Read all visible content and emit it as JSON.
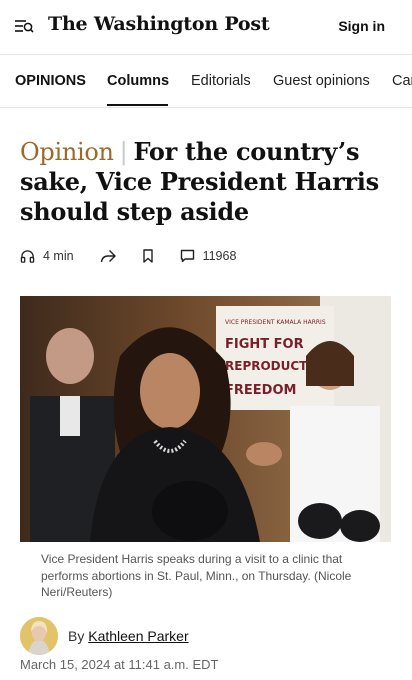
{
  "header": {
    "masthead": "The Washington Post",
    "signin_label": "Sign in",
    "menu_icon": "menu-search-icon"
  },
  "nav": {
    "items": [
      "OPINIONS",
      "Columns",
      "Editorials",
      "Guest opinions",
      "Car"
    ],
    "active": "Columns"
  },
  "article": {
    "kicker": "Opinion",
    "divider": "|",
    "headline": "For the country’s sake, Vice President Harris should step aside",
    "read_time": "4 min",
    "comment_count": "11968",
    "action_icons": [
      "headphones-icon",
      "share-icon",
      "bookmark-icon",
      "comment-icon"
    ],
    "photo": {
      "sign_lines": [
        "VICE PRESIDENT KAMALA HARRIS",
        "FIGHT FOR",
        "REPRODUCTIVE",
        "FREEDOM"
      ]
    },
    "caption": "Vice President Harris speaks during a visit to a clinic that performs abortions in St. Paul, Minn., on Thursday. (Nicole Neri/Reuters)",
    "byline_prefix": "By",
    "author": "Kathleen Parker",
    "date": "March 15, 2024 at 11:41 a.m. EDT"
  },
  "colors": {
    "kicker": "#9a6a2c",
    "text": "#111111",
    "muted": "#666666",
    "border": "#e5e5e5"
  }
}
